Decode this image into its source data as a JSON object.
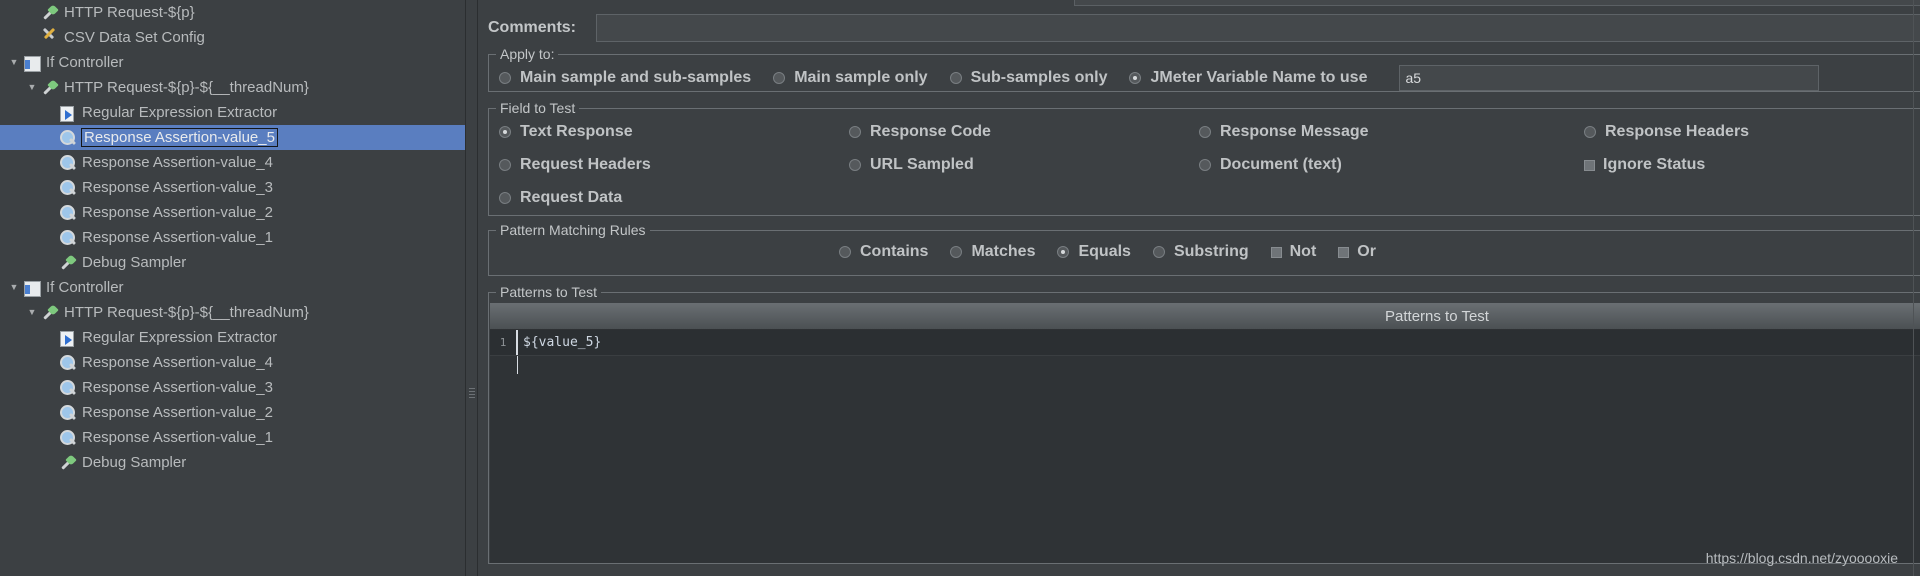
{
  "tree": {
    "items": [
      {
        "label": "HTTP Request-${p}",
        "icon": "pipette-icon",
        "indent": 1,
        "twisty": "",
        "selected": false
      },
      {
        "label": "CSV Data Set Config",
        "icon": "config-icon",
        "indent": 1,
        "twisty": "",
        "selected": false
      },
      {
        "label": "If Controller",
        "icon": "controller-icon",
        "indent": 0,
        "twisty": "▼",
        "selected": false
      },
      {
        "label": "HTTP Request-${p}-${__threadNum}",
        "icon": "pipette-icon",
        "indent": 1,
        "twisty": "▼",
        "selected": false
      },
      {
        "label": "Regular Expression Extractor",
        "icon": "extractor-icon",
        "indent": 2,
        "twisty": "",
        "selected": false
      },
      {
        "label": "Response Assertion-value_5",
        "icon": "assertion-icon",
        "indent": 2,
        "twisty": "",
        "selected": true
      },
      {
        "label": "Response Assertion-value_4",
        "icon": "assertion-icon",
        "indent": 2,
        "twisty": "",
        "selected": false
      },
      {
        "label": "Response Assertion-value_3",
        "icon": "assertion-icon",
        "indent": 2,
        "twisty": "",
        "selected": false
      },
      {
        "label": "Response Assertion-value_2",
        "icon": "assertion-icon",
        "indent": 2,
        "twisty": "",
        "selected": false
      },
      {
        "label": "Response Assertion-value_1",
        "icon": "assertion-icon",
        "indent": 2,
        "twisty": "",
        "selected": false
      },
      {
        "label": "Debug Sampler",
        "icon": "pipette-icon",
        "indent": 2,
        "twisty": "",
        "selected": false
      },
      {
        "label": "If Controller",
        "icon": "controller-icon",
        "indent": 0,
        "twisty": "▼",
        "selected": false
      },
      {
        "label": "HTTP Request-${p}-${__threadNum}",
        "icon": "pipette-icon",
        "indent": 1,
        "twisty": "▼",
        "selected": false
      },
      {
        "label": "Regular Expression Extractor",
        "icon": "extractor-icon",
        "indent": 2,
        "twisty": "",
        "selected": false
      },
      {
        "label": "Response Assertion-value_4",
        "icon": "assertion-icon",
        "indent": 2,
        "twisty": "",
        "selected": false
      },
      {
        "label": "Response Assertion-value_3",
        "icon": "assertion-icon",
        "indent": 2,
        "twisty": "",
        "selected": false
      },
      {
        "label": "Response Assertion-value_2",
        "icon": "assertion-icon",
        "indent": 2,
        "twisty": "",
        "selected": false
      },
      {
        "label": "Response Assertion-value_1",
        "icon": "assertion-icon",
        "indent": 2,
        "twisty": "",
        "selected": false
      },
      {
        "label": "Debug Sampler",
        "icon": "pipette-icon",
        "indent": 2,
        "twisty": "",
        "selected": false
      }
    ]
  },
  "comments": {
    "label": "Comments:",
    "value": "",
    "placeholder": ""
  },
  "apply_to": {
    "legend": "Apply to:",
    "options": [
      {
        "label": "Main sample and sub-samples",
        "selected": false
      },
      {
        "label": "Main sample only",
        "selected": false
      },
      {
        "label": "Sub-samples only",
        "selected": false
      },
      {
        "label": "JMeter Variable Name to use",
        "selected": true
      }
    ],
    "variable_value": "a5"
  },
  "field_to_test": {
    "legend": "Field to Test",
    "options": [
      {
        "label": "Text Response",
        "type": "radio",
        "selected": true
      },
      {
        "label": "Response Code",
        "type": "radio",
        "selected": false
      },
      {
        "label": "Response Message",
        "type": "radio",
        "selected": false
      },
      {
        "label": "Response Headers",
        "type": "radio",
        "selected": false
      },
      {
        "label": "Request Headers",
        "type": "radio",
        "selected": false
      },
      {
        "label": "URL Sampled",
        "type": "radio",
        "selected": false
      },
      {
        "label": "Document (text)",
        "type": "radio",
        "selected": false
      },
      {
        "label": "Ignore Status",
        "type": "checkbox",
        "selected": false
      },
      {
        "label": "Request Data",
        "type": "radio",
        "selected": false
      }
    ]
  },
  "pattern_matching_rules": {
    "legend": "Pattern Matching Rules",
    "options": [
      {
        "label": "Contains",
        "type": "radio",
        "selected": false
      },
      {
        "label": "Matches",
        "type": "radio",
        "selected": false
      },
      {
        "label": "Equals",
        "type": "radio",
        "selected": true
      },
      {
        "label": "Substring",
        "type": "radio",
        "selected": false
      },
      {
        "label": "Not",
        "type": "checkbox",
        "selected": false
      },
      {
        "label": "Or",
        "type": "checkbox",
        "selected": false
      }
    ]
  },
  "patterns_to_test": {
    "legend": "Patterns to Test",
    "column_header": "Patterns to Test",
    "rows": [
      {
        "num": "1",
        "value": "${value_5}"
      }
    ]
  },
  "watermark": "https://blog.csdn.net/zyooooxie",
  "colors": {
    "background": "#3c4043",
    "selection": "#5a7ec0",
    "text": "#c0c3c5",
    "field_bg": "#44484b"
  }
}
